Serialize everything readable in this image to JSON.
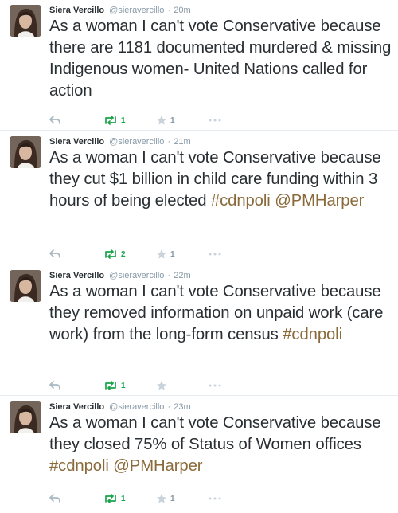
{
  "tweets": [
    {
      "name": "Siera Vercillo",
      "handle": "@sieravercillo",
      "time": "20m",
      "text_before": "As a woman I can't vote Conservative because there are 1181 documented murdered & missing Indigenous women- United Nations called for action",
      "hashtag": "",
      "mention": "",
      "retweets": "1",
      "favorites": "1"
    },
    {
      "name": "Siera Vercillo",
      "handle": "@sieravercillo",
      "time": "21m",
      "text_before": "As a woman I can't vote Conservative because they cut $1 billion in child care funding within 3 hours of being elected ",
      "hashtag": "#cdnpoli",
      "mention": "@PMHarper",
      "retweets": "2",
      "favorites": "1"
    },
    {
      "name": "Siera Vercillo",
      "handle": "@sieravercillo",
      "time": "22m",
      "text_before": "As a woman I can't vote Conservative because they removed information on unpaid work (care work) from the long-form census ",
      "hashtag": "#cdnpoli",
      "mention": "",
      "retweets": "1",
      "favorites": ""
    },
    {
      "name": "Siera Vercillo",
      "handle": "@sieravercillo",
      "time": "23m",
      "text_before": "As a woman I can't vote Conservative because they closed 75% of Status of Women offices ",
      "hashtag": "#cdnpoli",
      "mention": "@PMHarper",
      "retweets": "1",
      "favorites": "1"
    }
  ],
  "colors": {
    "retweet": "#19a34a",
    "link": "#8a6a3a",
    "muted": "#8899a6"
  },
  "icons": {
    "reply": "reply-icon",
    "retweet": "retweet-icon",
    "favorite": "star-icon",
    "more": "more-icon"
  }
}
